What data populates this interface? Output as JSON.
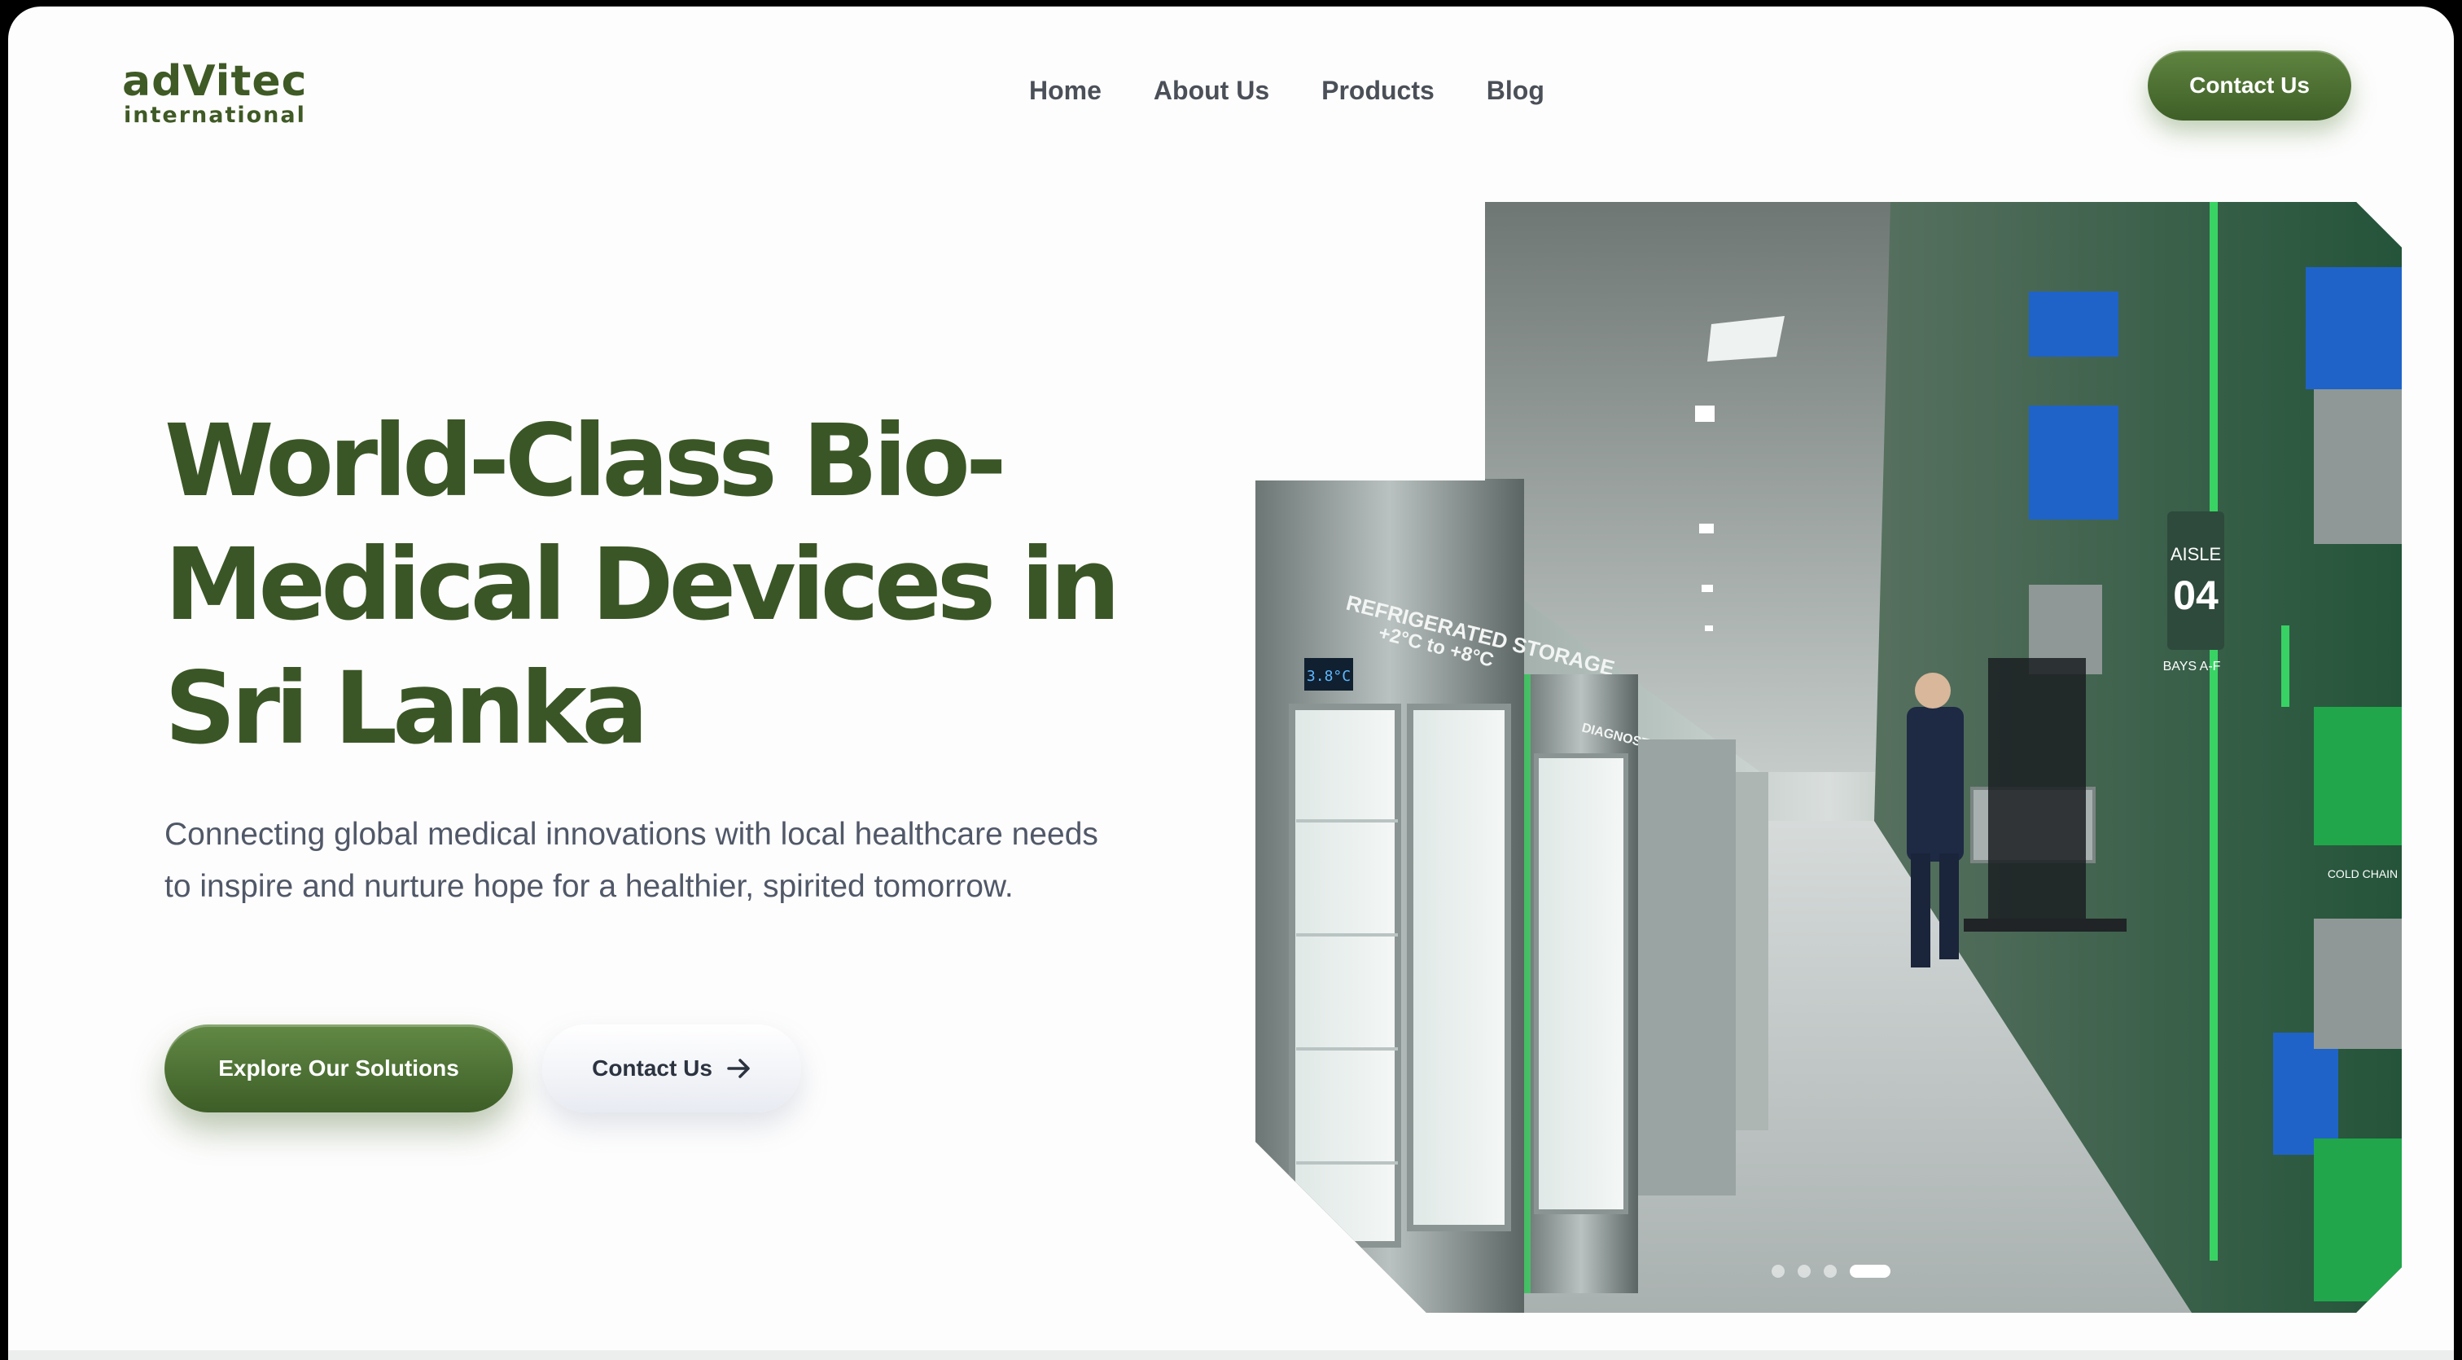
{
  "header": {
    "logo_word": "adVitec",
    "logo_sub": "international",
    "nav": [
      "Home",
      "About Us",
      "Products",
      "Blog"
    ],
    "cta": "Contact Us"
  },
  "hero": {
    "title_lines": [
      "World-Class Bio-",
      "Medical Devices in",
      "Sri Lanka"
    ],
    "subtitle": "Connecting global medical innovations with local healthcare needs to inspire and nurture hope for a healthier, spirited tomorrow.",
    "primary_button": "Explore Our Solutions",
    "secondary_button": "Contact Us"
  },
  "image_signage": {
    "storage_label": "REFRIGERATED STORAGE",
    "temp_range": "+2°C to +8°C",
    "display_temp": "3.8°C",
    "cabinet_label": "DIAGNOSTICS",
    "aisle_label": "AISLE",
    "aisle_number": "04",
    "bays": "BAYS A-F",
    "crate_label": "COLD CHAIN"
  },
  "carousel": {
    "slide_count": 4,
    "active_index": 3
  },
  "colors": {
    "brand_green": "#3b5626",
    "button_green": "#4e7233",
    "nav_text": "#4a4f58",
    "body_text": "#505868"
  }
}
